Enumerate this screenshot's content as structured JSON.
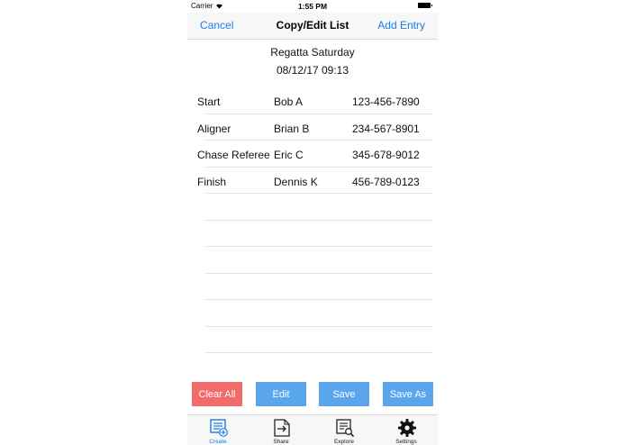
{
  "status": {
    "carrier": "Carrier",
    "time": "1:55 PM"
  },
  "nav": {
    "left": "Cancel",
    "title": "Copy/Edit List",
    "right": "Add Entry"
  },
  "list": {
    "name": "Regatta Saturday",
    "date": "08/12/17 09:13",
    "entries": [
      {
        "role": "Start",
        "name": "Bob A",
        "phone": "123-456-7890"
      },
      {
        "role": "Aligner",
        "name": "Brian B",
        "phone": "234-567-8901"
      },
      {
        "role": "Chase Referee",
        "name": "Eric C",
        "phone": "345-678-9012"
      },
      {
        "role": "Finish",
        "name": "Dennis K",
        "phone": "456-789-0123"
      },
      {
        "role": "",
        "name": "",
        "phone": ""
      },
      {
        "role": "",
        "name": "",
        "phone": ""
      },
      {
        "role": "",
        "name": "",
        "phone": ""
      },
      {
        "role": "",
        "name": "",
        "phone": ""
      },
      {
        "role": "",
        "name": "",
        "phone": ""
      },
      {
        "role": "",
        "name": "",
        "phone": ""
      }
    ]
  },
  "actions": {
    "clear_all": "Clear All",
    "edit": "Edit",
    "save": "Save",
    "save_as": "Save As"
  },
  "tabs": [
    {
      "label": "Create",
      "icon": "create-list-icon",
      "active": true
    },
    {
      "label": "Share",
      "icon": "share-icon",
      "active": false
    },
    {
      "label": "Explore",
      "icon": "explore-icon",
      "active": false
    },
    {
      "label": "Settings",
      "icon": "settings-icon",
      "active": false
    }
  ],
  "colors": {
    "accent": "#1a7ee6",
    "button_blue": "#5aa6ec",
    "button_red": "#f26b6b"
  }
}
